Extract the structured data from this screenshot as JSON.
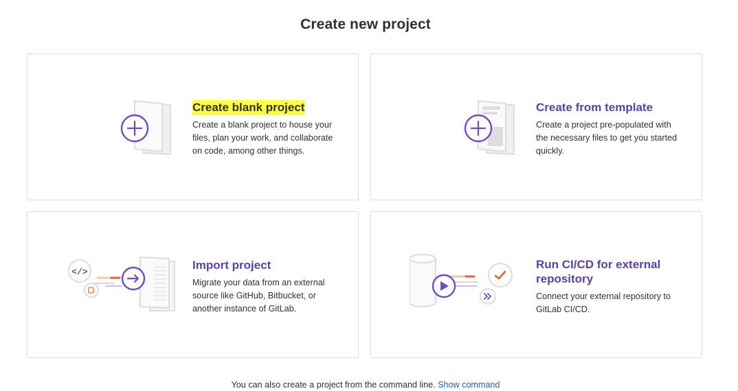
{
  "page": {
    "title": "Create new project"
  },
  "cards": [
    {
      "title": "Create blank project",
      "description": "Create a blank project to house your files, plan your work, and collaborate on code, among other things.",
      "icon": "blank-project-icon"
    },
    {
      "title": "Create from template",
      "description": "Create a project pre-populated with the necessary files to get you started quickly.",
      "icon": "template-project-icon"
    },
    {
      "title": "Import project",
      "description": "Migrate your data from an external source like GitHub, Bitbucket, or another instance of GitLab.",
      "icon": "import-project-icon"
    },
    {
      "title": "Run CI/CD for external repository",
      "description": "Connect your external repository to GitLab CI/CD.",
      "icon": "ci-cd-external-icon"
    }
  ],
  "footer": {
    "text": "You can also create a project from the command line.",
    "link": "Show command"
  },
  "colors": {
    "accent": "#6e49cb",
    "highlight": "#ffff3c",
    "link": "#1f62b8",
    "border": "#dbdbdb"
  }
}
